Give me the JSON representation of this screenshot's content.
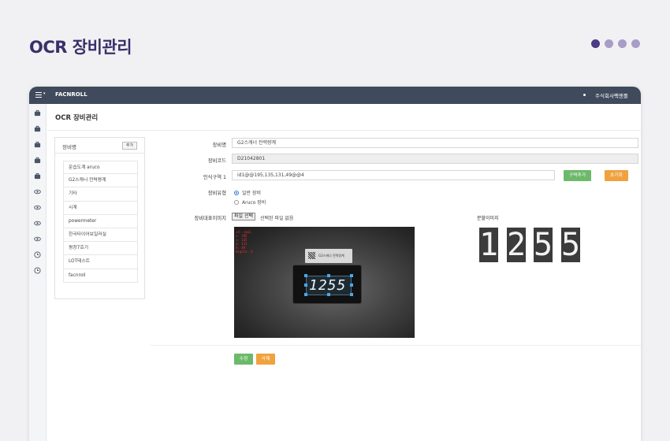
{
  "slide": {
    "title": "OCR 장비관리"
  },
  "app": {
    "brand": "FACNROLL",
    "user": "주식회사팩앤롤"
  },
  "page": {
    "heading": "OCR 장비관리"
  },
  "list": {
    "header": "장비명",
    "add_label": "추가",
    "items": [
      "운습도계 aruco",
      "G2스캐너 전력량계",
      "기타",
      "시계",
      "powermeter",
      "한국타이어보일러실",
      "평창7호기",
      "LOT테스트",
      "facnroll"
    ]
  },
  "form": {
    "name_label": "장비명",
    "name_value": "G2스캐너 전력량계",
    "code_label": "장비코드",
    "code_value": "D21042801",
    "region_label": "인식구역 1",
    "region_value": "id1@@195,135,131,49@@4",
    "region_add_label": "구역추가",
    "reset_label": "초기화",
    "type_label": "장비유형",
    "type_options": [
      "일반 장비",
      "Aruco 장비"
    ],
    "image_label": "장비대표이미지",
    "file_button": "파일 선택",
    "file_status": "선택된 파일 없음",
    "crop_label": "분할이미지",
    "ocr_lines": [
      "id: cap1",
      "x: 195",
      "y: 135",
      "w: 131",
      "h: 49",
      "digits: 4"
    ],
    "label_card_text": "G2스캐너 전력량계",
    "display_reading": "1255",
    "crop_digits": [
      "1",
      "2",
      "5",
      "5"
    ],
    "edit_label": "수정",
    "delete_label": "삭제"
  },
  "colors": {
    "topbar": "#3f4a5c",
    "primary_green": "#6cb96a",
    "accent_orange": "#f0a23e",
    "title_purple": "#3b2f6b"
  }
}
